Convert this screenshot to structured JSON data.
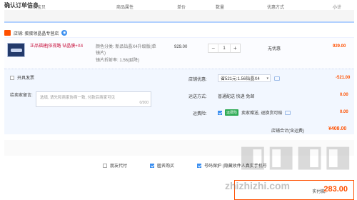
{
  "page_title": "确认订单信息",
  "columns": [
    "店铺宝贝",
    "商品属性",
    "单价",
    "数量",
    "优惠方式",
    "小计"
  ],
  "shop": {
    "name": "店铺: 蛋蛋领晶晶专营店"
  },
  "item": {
    "name": "正品福建|依视路 钻晶膜+X4升...",
    "attr1": "颜色分类: 新品钻晶X4升级版(单",
    "attr2": "镜片)",
    "attr3": "镜片折射率: 1.56(延降)",
    "price": "929.00",
    "quantity": "1",
    "promo": "无优惠",
    "subtotal": "929.00"
  },
  "gift_checkbox_label": "开具发票",
  "message_label": "给卖家留言:",
  "message_placeholder": "选填, 请先和商家协商一致, 付款后商家可见",
  "message_counter": "0/200",
  "coupon": {
    "label": "店铺优惠:",
    "selected": "省521元:1.56钻晶X4",
    "amount": "-521.00"
  },
  "shipping": {
    "label": "运送方式:",
    "value": "普通配送 快递 免邮",
    "amount": "0.00"
  },
  "insurance": {
    "label": "运费险:",
    "tag": "运费险",
    "value": "卖家赠送, 退换货可赔",
    "amount": "0.00"
  },
  "shop_total": {
    "label": "店铺合计(含运费)",
    "amount": "¥408.00"
  },
  "options": [
    {
      "label": "朋友代付",
      "checked": false
    },
    {
      "label": "匿名购买",
      "checked": true
    },
    {
      "label": "号码保护 (隐藏收件人真实手机号",
      "checked": true
    }
  ],
  "pay": {
    "label": "实付款:",
    "amount": "283.00"
  },
  "watermark": "zhizhizhi.com",
  "colors": {
    "accent": "#ff5000",
    "blue": "#3b8ff0",
    "header_line": "#b2d1ff"
  }
}
